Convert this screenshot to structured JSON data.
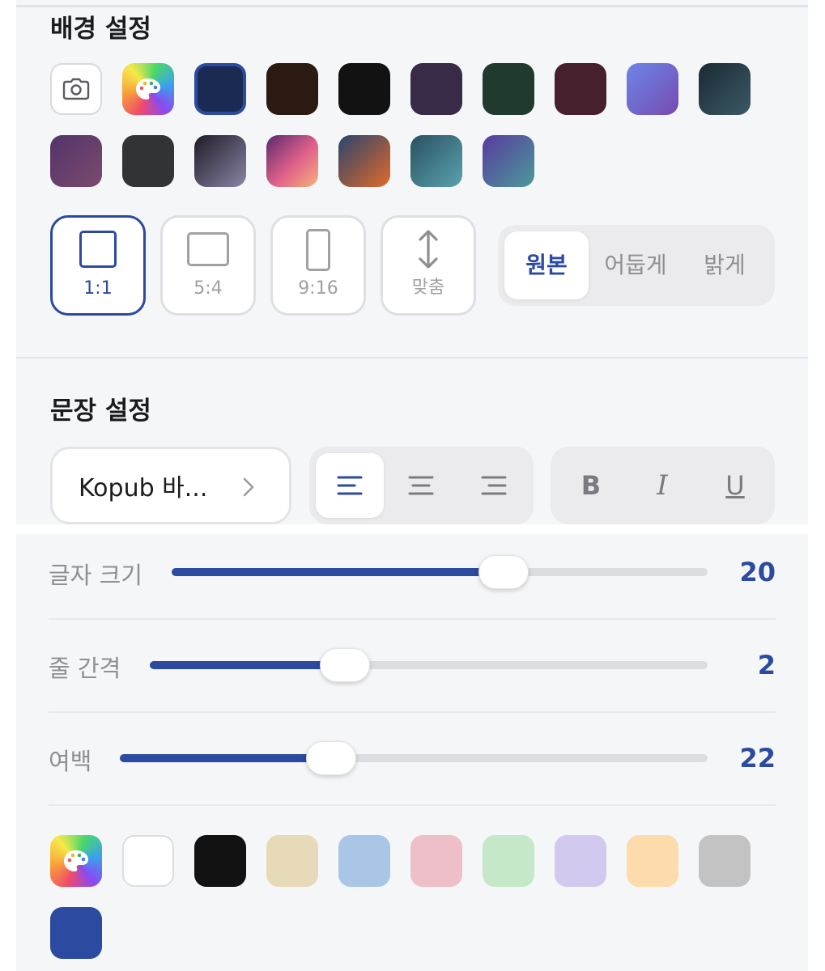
{
  "background_section": {
    "title": "배경 설정",
    "camera_icon": "camera-icon",
    "palette_icon": "palette-icon",
    "swatches_row1": [
      {
        "name": "navy",
        "fill": "#1b2a52",
        "selected": true
      },
      {
        "name": "dark-brown",
        "fill": "#2a1a11"
      },
      {
        "name": "black",
        "fill": "#121212"
      },
      {
        "name": "dark-purple",
        "fill": "#382b47"
      },
      {
        "name": "dark-green",
        "fill": "#213a30"
      },
      {
        "name": "wine",
        "fill": "#46202c"
      },
      {
        "name": "violet-gradient",
        "fill": "linear-gradient(135deg,#6c86e6,#764ab2)"
      },
      {
        "name": "slate-gradient",
        "fill": "linear-gradient(135deg,#1a2a33,#3b5a66)"
      }
    ],
    "swatches_row2": [
      {
        "name": "plum-gradient",
        "fill": "linear-gradient(135deg,#523469,#7c4a6e)"
      },
      {
        "name": "charcoal",
        "fill": "#323335"
      },
      {
        "name": "dusk-gradient",
        "fill": "linear-gradient(135deg,#1e1b25,#8b85a8)"
      },
      {
        "name": "sunset-gradient",
        "fill": "linear-gradient(135deg,#5a2a6e,#e0608a 55%,#f5b37a)"
      },
      {
        "name": "ember-gradient",
        "fill": "linear-gradient(135deg,#2a4470,#e06a28)"
      },
      {
        "name": "teal-gradient",
        "fill": "linear-gradient(135deg,#2a5060,#5aa2ae)"
      },
      {
        "name": "aurora-gradient",
        "fill": "linear-gradient(135deg,#5a3a9e,#4a9a9a)"
      }
    ],
    "ratios": [
      {
        "label": "1:1",
        "active": true
      },
      {
        "label": "5:4"
      },
      {
        "label": "9:16"
      },
      {
        "label": "맞춤",
        "icon": "vertical-arrows-icon"
      }
    ],
    "brightness": {
      "options": [
        "원본",
        "어둡게",
        "밝게"
      ],
      "selected": "원본"
    }
  },
  "text_section": {
    "title": "문장 설정",
    "font": "Kopub 바...",
    "chevron_icon": "chevron-right-icon",
    "align": {
      "options": [
        "align-left-icon",
        "align-center-icon",
        "align-right-icon"
      ],
      "selected": "align-left-icon"
    },
    "style_buttons": [
      "B",
      "I",
      "U"
    ],
    "sliders": [
      {
        "label": "글자 크기",
        "value": "20",
        "fraction": 0.62
      },
      {
        "label": "줄 간격",
        "value": "2",
        "fraction": 0.35
      },
      {
        "label": "여백",
        "value": "22",
        "fraction": 0.36
      }
    ],
    "text_colors": [
      {
        "name": "white",
        "fill": "#ffffff"
      },
      {
        "name": "black",
        "fill": "#121212"
      },
      {
        "name": "beige",
        "fill": "#e7dab8"
      },
      {
        "name": "light-blue",
        "fill": "#aac6e6"
      },
      {
        "name": "pink",
        "fill": "#efbfc9"
      },
      {
        "name": "mint",
        "fill": "#c4e8c8"
      },
      {
        "name": "lavender",
        "fill": "#d3c9ef"
      },
      {
        "name": "peach",
        "fill": "#fcdcac"
      },
      {
        "name": "gray",
        "fill": "#c3c3c3"
      },
      {
        "name": "royal-blue",
        "fill": "#2b4aa0"
      }
    ]
  },
  "colors": {
    "accent": "#2b4aa0",
    "panel": "#f5f6f8",
    "muted_text": "#8e8e93"
  }
}
